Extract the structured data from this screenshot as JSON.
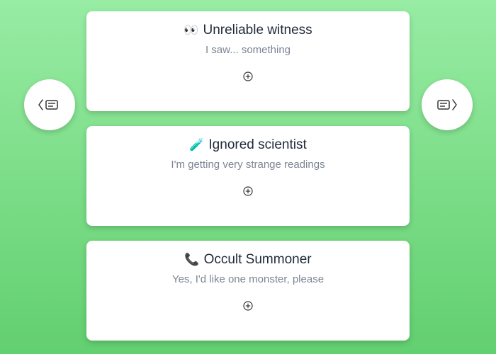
{
  "cards": [
    {
      "emoji": "👀",
      "title": "Unreliable witness",
      "subtitle": "I saw... something"
    },
    {
      "emoji": "🧪",
      "title": "Ignored scientist",
      "subtitle": "I'm getting very strange readings"
    },
    {
      "emoji": "📞",
      "title": "Occult Summoner",
      "subtitle": "Yes, I'd like one monster, please"
    }
  ],
  "icons": {
    "previous": "chevron-left-notes-icon",
    "next": "notes-chevron-right-icon",
    "add": "circle-plus-icon"
  },
  "colors": {
    "background_top": "#98eca4",
    "background_bottom": "#62cf70",
    "card": "#ffffff",
    "title_text": "#1f2a3a",
    "subtitle_text": "#7b8593"
  }
}
